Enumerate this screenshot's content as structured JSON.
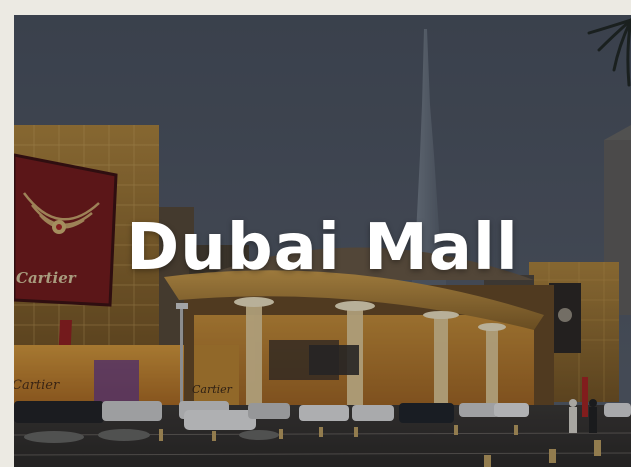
{
  "card": {
    "title": "Dubai Mall",
    "billboard_brand": "Cartier",
    "storefront_brand_left": "Cartier",
    "storefront_brand_center": "Cartier"
  },
  "colors": {
    "sky": "#4a5463",
    "facade_gold": "#c89a3a",
    "title_text": "#ffffff",
    "page_background": "#eceae3"
  }
}
